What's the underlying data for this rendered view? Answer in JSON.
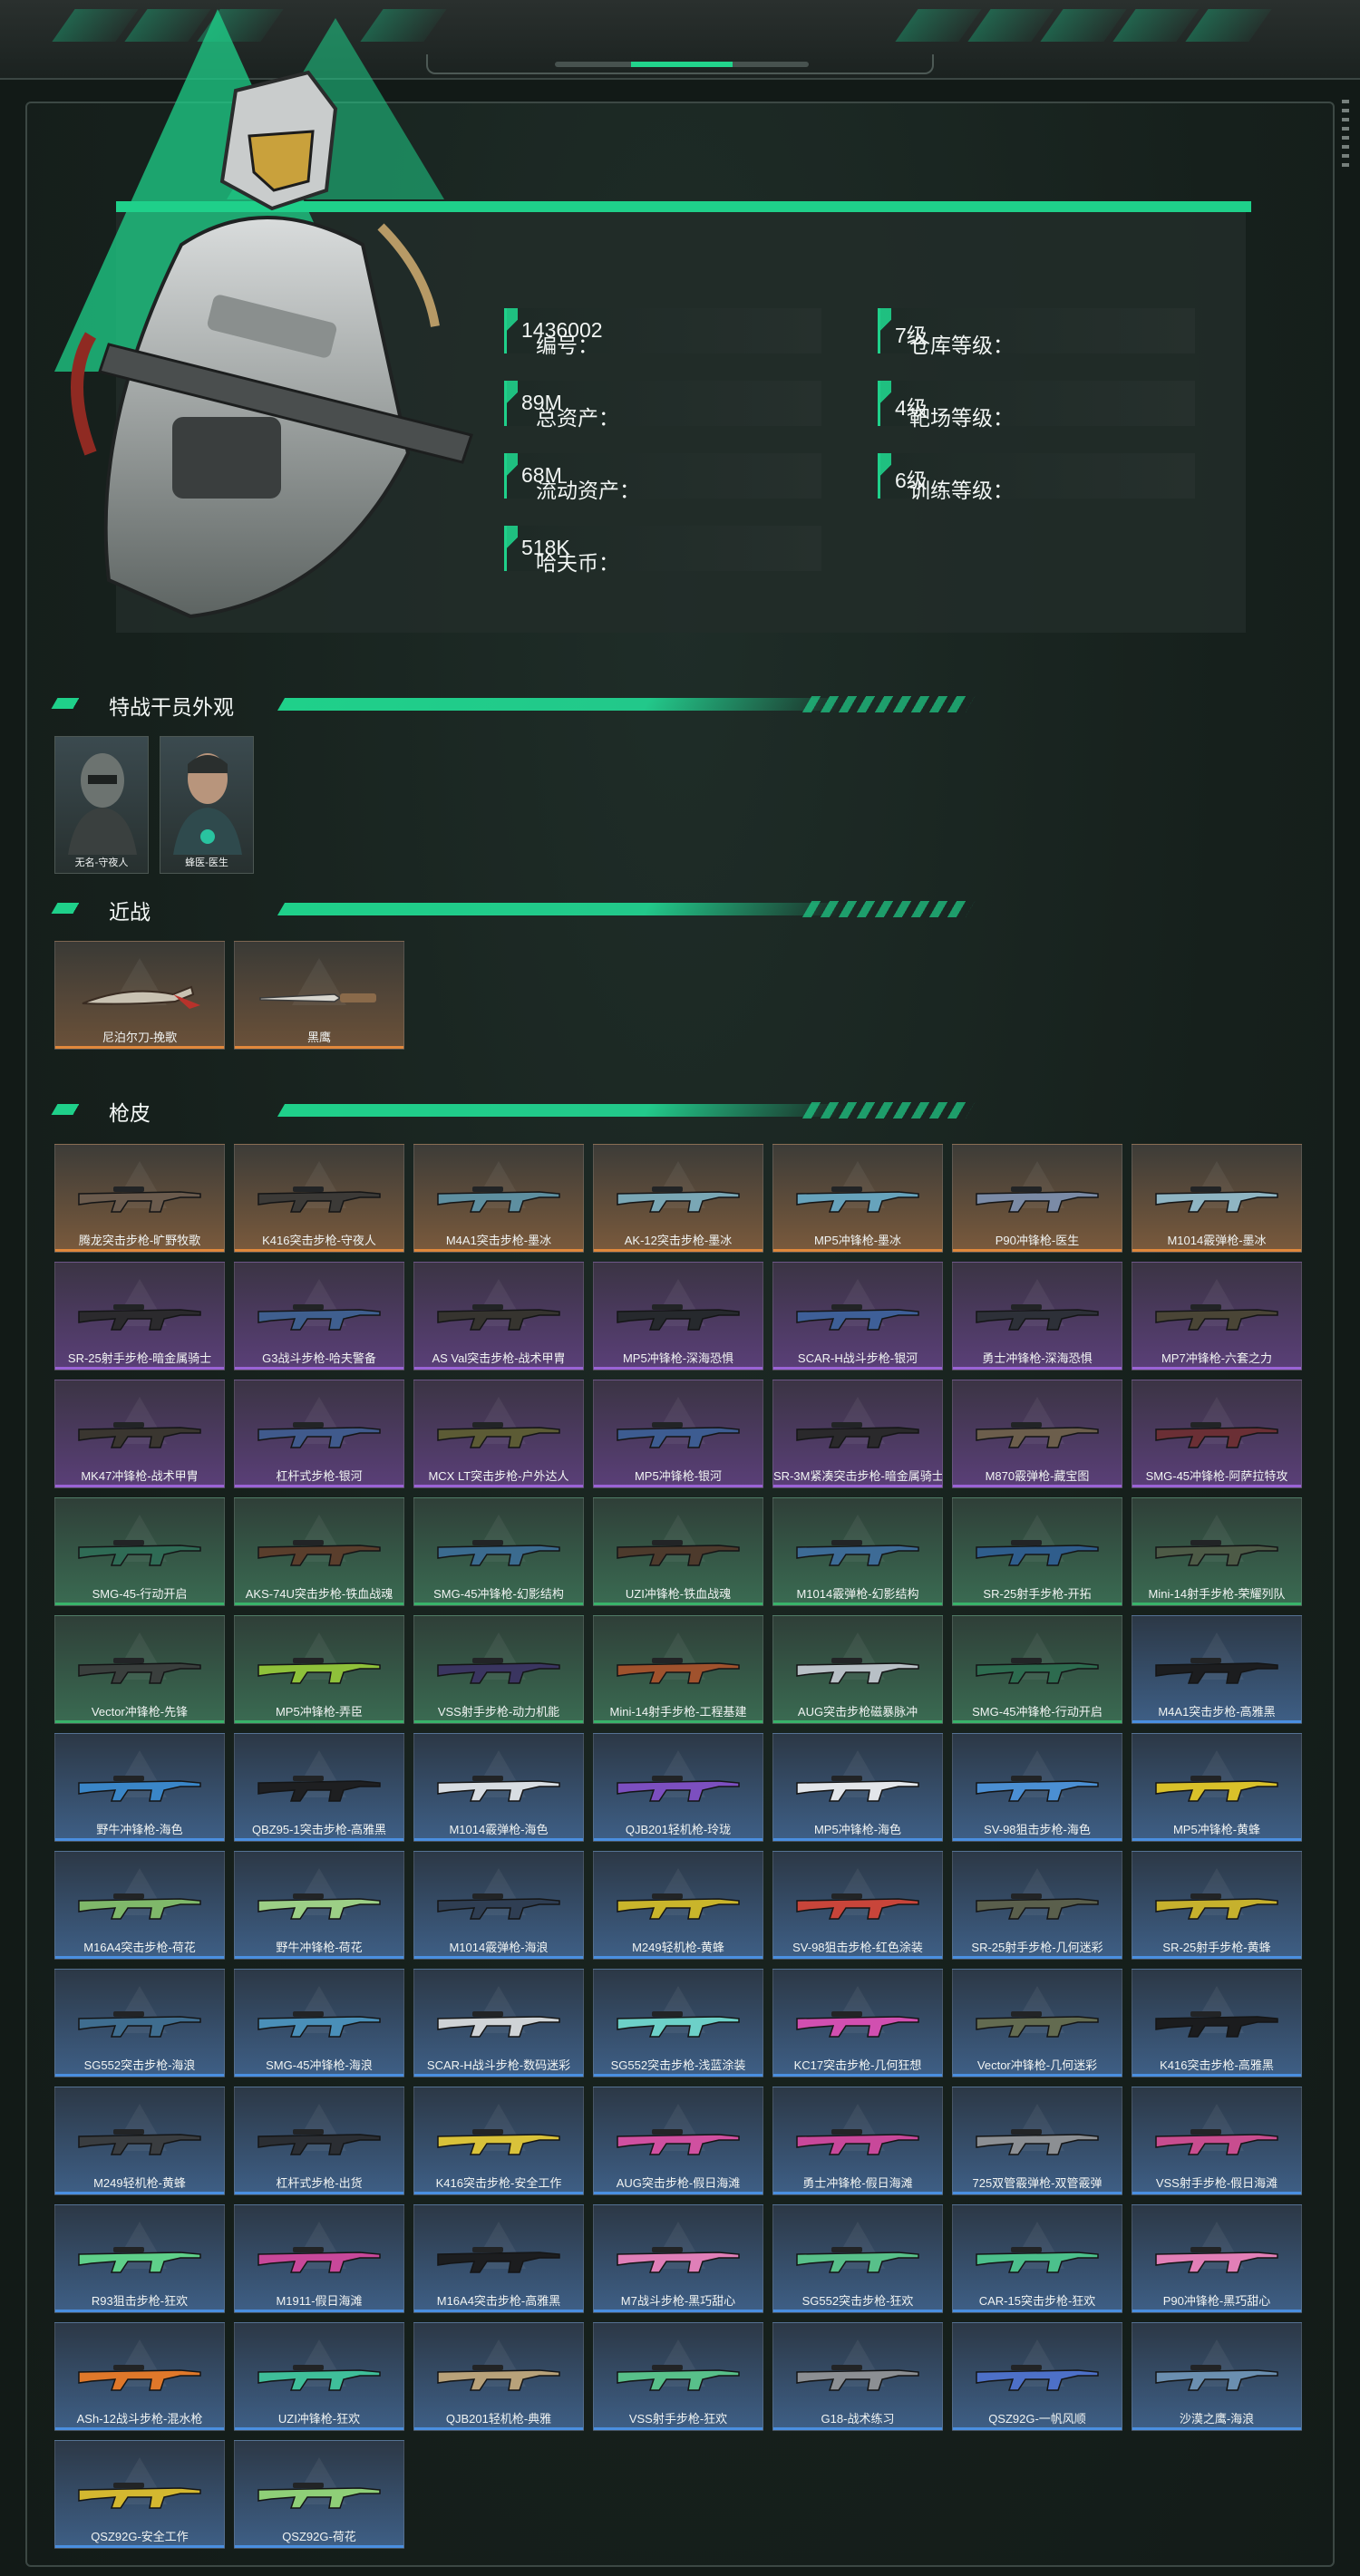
{
  "profile": {
    "stats": [
      {
        "label": "编号：",
        "value": "1436002"
      },
      {
        "label": "仓库等级：",
        "value": "7级"
      },
      {
        "label": "总资产：",
        "value": "89M"
      },
      {
        "label": "靶场等级：",
        "value": "4级"
      },
      {
        "label": "流动资产：",
        "value": "68M"
      },
      {
        "label": "训练等级：",
        "value": "6级"
      },
      {
        "label": "哈夫币：",
        "value": "518K"
      }
    ]
  },
  "sections": {
    "operators_title": "特战干员外观",
    "melee_title": "近战",
    "guns_title": "枪皮"
  },
  "operators": [
    "无名-守夜人",
    "蜂医-医生"
  ],
  "melee": [
    "尼泊尔刀-挽歌",
    "黑鹰"
  ],
  "rarity_colors": {
    "orange": "#e0883c",
    "purple": "#9a63d6",
    "green": "#39b36a",
    "blue": "#4a8fe0"
  },
  "guns": [
    {
      "name": "腾龙突击步枪-旷野牧歌",
      "rarity": "orange",
      "color": "#6b5b4d"
    },
    {
      "name": "K416突击步枪-守夜人",
      "rarity": "orange",
      "color": "#3c3a37"
    },
    {
      "name": "M4A1突击步枪-墨冰",
      "rarity": "orange",
      "color": "#5e8fa0"
    },
    {
      "name": "AK-12突击步枪-墨冰",
      "rarity": "orange",
      "color": "#7aa7b5"
    },
    {
      "name": "MP5冲锋枪-墨冰",
      "rarity": "orange",
      "color": "#67a3bc"
    },
    {
      "name": "P90冲锋枪-医生",
      "rarity": "orange",
      "color": "#7b8ba6"
    },
    {
      "name": "M1014霰弹枪-墨冰",
      "rarity": "orange",
      "color": "#8fb5c3"
    },
    {
      "name": "SR-25射手步枪-暗金属骑士",
      "rarity": "purple",
      "color": "#2b2a2d"
    },
    {
      "name": "G3战斗步枪-哈夫警备",
      "rarity": "purple",
      "color": "#3f5f8f"
    },
    {
      "name": "AS Val突击步枪-战术甲胄",
      "rarity": "purple",
      "color": "#36342f"
    },
    {
      "name": "MP5冲锋枪-深海恐惧",
      "rarity": "purple",
      "color": "#26292d"
    },
    {
      "name": "SCAR-H战斗步枪-银河",
      "rarity": "purple",
      "color": "#3e5f98"
    },
    {
      "name": "勇士冲锋枪-深海恐惧",
      "rarity": "purple",
      "color": "#2d3038"
    },
    {
      "name": "MP7冲锋枪-六套之力",
      "rarity": "purple",
      "color": "#4a4536"
    },
    {
      "name": "MK47冲锋枪-战术甲胄",
      "rarity": "purple",
      "color": "#3a3630"
    },
    {
      "name": "杠杆式步枪-银河",
      "rarity": "purple",
      "color": "#405a8c"
    },
    {
      "name": "MCX LT突击步枪-户外达人",
      "rarity": "purple",
      "color": "#5c5b35"
    },
    {
      "name": "MP5冲锋枪-银河",
      "rarity": "purple",
      "color": "#3d5c91"
    },
    {
      "name": "SR-3M紧凑突击步枪-暗金属骑士",
      "rarity": "purple",
      "color": "#2a292b"
    },
    {
      "name": "M870霰弹枪-藏宝图",
      "rarity": "purple",
      "color": "#6c5e4c"
    },
    {
      "name": "SMG-45冲锋枪-阿萨拉特攻",
      "rarity": "purple",
      "color": "#6b2f35"
    },
    {
      "name": "SMG-45-行动开启",
      "rarity": "green",
      "color": "#2f6b55"
    },
    {
      "name": "AKS-74U突击步枪-铁血战魂",
      "rarity": "green",
      "color": "#5a3e2c"
    },
    {
      "name": "SMG-45冲锋枪-幻影结构",
      "rarity": "green",
      "color": "#3b6b8f"
    },
    {
      "name": "UZI冲锋枪-铁血战魂",
      "rarity": "green",
      "color": "#4d3a2c"
    },
    {
      "name": "M1014霰弹枪-幻影结构",
      "rarity": "green",
      "color": "#3d6b96"
    },
    {
      "name": "SR-25射手步枪-开拓",
      "rarity": "green",
      "color": "#2f5d8c"
    },
    {
      "name": "Mini-14射手步枪-荣耀列队",
      "rarity": "green",
      "color": "#4d5a46"
    },
    {
      "name": "Vector冲锋枪-先锋",
      "rarity": "green",
      "color": "#3a3f3d"
    },
    {
      "name": "MP5冲锋枪-弄臣",
      "rarity": "green",
      "color": "#8fc13a"
    },
    {
      "name": "VSS射手步枪-动力机能",
      "rarity": "green",
      "color": "#3a3560"
    },
    {
      "name": "Mini-14射手步枪-工程基建",
      "rarity": "green",
      "color": "#a0522d"
    },
    {
      "name": "AUG突击步枪磁暴脉冲",
      "rarity": "green",
      "color": "#b8c0c6"
    },
    {
      "name": "SMG-45冲锋枪-行动开启",
      "rarity": "green",
      "color": "#2d6b4f"
    },
    {
      "name": "M4A1突击步枪-高雅黑",
      "rarity": "blue",
      "color": "#1c1d1f"
    },
    {
      "name": "野牛冲锋枪-海色",
      "rarity": "blue",
      "color": "#3a86c8"
    },
    {
      "name": "QBZ95-1突击步枪-高雅黑",
      "rarity": "blue",
      "color": "#1e1f21"
    },
    {
      "name": "M1014霰弹枪-海色",
      "rarity": "blue",
      "color": "#d8dde2"
    },
    {
      "name": "QJB201轻机枪-玲珑",
      "rarity": "blue",
      "color": "#7c4fc0"
    },
    {
      "name": "MP5冲锋枪-海色",
      "rarity": "blue",
      "color": "#e3e6ea"
    },
    {
      "name": "SV-98狙击步枪-海色",
      "rarity": "blue",
      "color": "#4b8fd3"
    },
    {
      "name": "MP5冲锋枪-黄蜂",
      "rarity": "blue",
      "color": "#d9c12a"
    },
    {
      "name": "M16A4突击步枪-荷花",
      "rarity": "blue",
      "color": "#7fb86a"
    },
    {
      "name": "野牛冲锋枪-荷花",
      "rarity": "blue",
      "color": "#9ccf86"
    },
    {
      "name": "M1014霰弹枪-海浪",
      "rarity": "blue",
      "color": "#2f3e53"
    },
    {
      "name": "M249轻机枪-黄蜂",
      "rarity": "blue",
      "color": "#c9b52b"
    },
    {
      "name": "SV-98狙击步枪-红色涂装",
      "rarity": "blue",
      "color": "#c8453a"
    },
    {
      "name": "SR-25射手步枪-几何迷彩",
      "rarity": "blue",
      "color": "#5a5f4c"
    },
    {
      "name": "SR-25射手步枪-黄蜂",
      "rarity": "blue",
      "color": "#c6b12d"
    },
    {
      "name": "SG552突击步枪-海浪",
      "rarity": "blue",
      "color": "#3f6d8f"
    },
    {
      "name": "SMG-45冲锋枪-海浪",
      "rarity": "blue",
      "color": "#4a8fb8"
    },
    {
      "name": "SCAR-H战斗步枪-数码迷彩",
      "rarity": "blue",
      "color": "#cfd3d6"
    },
    {
      "name": "SG552突击步枪-浅蓝涂装",
      "rarity": "blue",
      "color": "#6dd0c8"
    },
    {
      "name": "KC17突击步枪-几何狂想",
      "rarity": "blue",
      "color": "#d14fb0"
    },
    {
      "name": "Vector冲锋枪-几何迷彩",
      "rarity": "blue",
      "color": "#636b50"
    },
    {
      "name": "K416突击步枪-高雅黑",
      "rarity": "blue",
      "color": "#1b1c1e"
    },
    {
      "name": "M249轻机枪-黄蜂",
      "rarity": "blue",
      "color": "#3a3d40"
    },
    {
      "name": "杠杆式步枪-出货",
      "rarity": "blue",
      "color": "#2b2e33"
    },
    {
      "name": "K416突击步枪-安全工作",
      "rarity": "blue",
      "color": "#d9c23a"
    },
    {
      "name": "AUG突击步枪-假日海滩",
      "rarity": "blue",
      "color": "#d050a0"
    },
    {
      "name": "勇士冲锋枪-假日海滩",
      "rarity": "blue",
      "color": "#c8489a"
    },
    {
      "name": "725双管霰弹枪-双管霰弹",
      "rarity": "blue",
      "color": "#8c8f93"
    },
    {
      "name": "VSS射手步枪-假日海滩",
      "rarity": "blue",
      "color": "#c84d8f"
    },
    {
      "name": "R93狙击步枪-狂欢",
      "rarity": "blue",
      "color": "#5fd08a"
    },
    {
      "name": "M1911-假日海滩",
      "rarity": "blue",
      "color": "#c8489a"
    },
    {
      "name": "M16A4突击步枪-高雅黑",
      "rarity": "blue",
      "color": "#1c1d1f"
    },
    {
      "name": "M7战斗步枪-黑巧甜心",
      "rarity": "blue",
      "color": "#e07fb8"
    },
    {
      "name": "SG552突击步枪-狂欢",
      "rarity": "blue",
      "color": "#58c08a"
    },
    {
      "name": "CAR-15突击步枪-狂欢",
      "rarity": "blue",
      "color": "#4cc08c"
    },
    {
      "name": "P90冲锋枪-黑巧甜心",
      "rarity": "blue",
      "color": "#e27fb7"
    },
    {
      "name": "ASh-12战斗步枪-混水枪",
      "rarity": "blue",
      "color": "#e0782a"
    },
    {
      "name": "UZI冲锋枪-狂欢",
      "rarity": "blue",
      "color": "#3fbf9a"
    },
    {
      "name": "QJB201轻机枪-典雅",
      "rarity": "blue",
      "color": "#b8a27a"
    },
    {
      "name": "VSS射手步枪-狂欢",
      "rarity": "blue",
      "color": "#58c08a"
    },
    {
      "name": "G18-战术练习",
      "rarity": "blue",
      "color": "#8c8f93"
    },
    {
      "name": "QSZ92G-一帆风顺",
      "rarity": "blue",
      "color": "#4d70c8"
    },
    {
      "name": "沙漠之鹰-海浪",
      "rarity": "blue",
      "color": "#6b8fb0"
    },
    {
      "name": "QSZ92G-安全工作",
      "rarity": "blue",
      "color": "#d4b830"
    },
    {
      "name": "QSZ92G-荷花",
      "rarity": "blue",
      "color": "#8fcf78"
    }
  ]
}
